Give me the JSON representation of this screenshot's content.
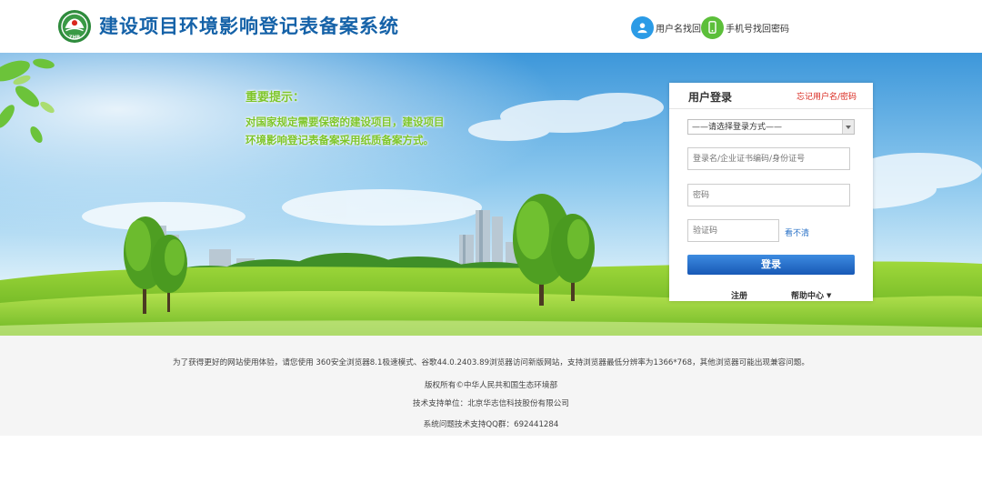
{
  "header": {
    "title": "建设项目环境影响登记表备案系统",
    "logo_icon": "zhb-emblem-icon",
    "logo_text": "ZHB",
    "links": [
      {
        "label": "用户名找回",
        "icon": "user-icon",
        "color": "#2b9be6"
      },
      {
        "label": "手机号找回密码",
        "icon": "mobile-phone-icon",
        "color": "#5cbf3a"
      }
    ]
  },
  "notice": {
    "title": "重要提示：",
    "lines": [
      "对国家规定需要保密的建设项目，建设项目",
      "环境影响登记表备案采用纸质备案方式。"
    ]
  },
  "login": {
    "title": "用户登录",
    "forgot_link": "忘记用户名/密码",
    "login_type": {
      "selected": "——请选择登录方式——",
      "options": [
        "——请选择登录方式——"
      ]
    },
    "username_placeholder": "登录名/企业证书编码/身份证号",
    "password_placeholder": "密码",
    "captcha_placeholder": "验证码",
    "captcha_refresh": "看不清",
    "submit_label": "登录",
    "register_label": "注册",
    "help_label": "帮助中心"
  },
  "footer": {
    "browser_notice": "为了获得更好的网站使用体验，请您使用 360安全浏览器8.1极速模式、谷歌44.0.2403.89浏览器访问新版网站，支持浏览器最低分辨率为1366*768，其他浏览器可能出现兼容问题。",
    "copyright": "版权所有©中华人民共和国生态环境部",
    "tech_support": "技术支持单位：北京华志信科技股份有限公司",
    "qq_support": "系统问题技术支持QQ群：692441284"
  },
  "colors": {
    "title_blue": "#1562a8",
    "notice_green": "#7dc52a",
    "forgot_red": "#d9261c",
    "button_blue": "#1f66c0"
  }
}
